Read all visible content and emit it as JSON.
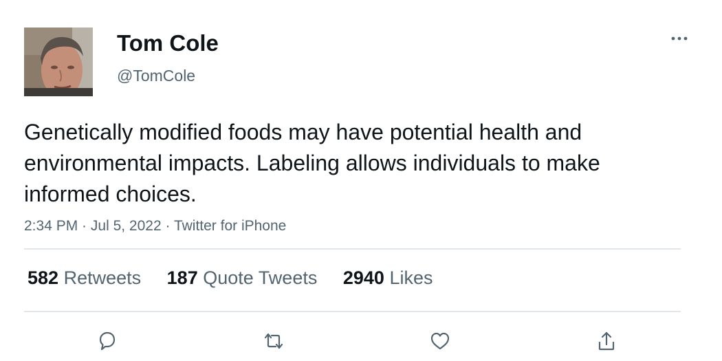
{
  "author": {
    "name": "Tom Cole",
    "handle": "@TomCole"
  },
  "tweet": {
    "text": "Genetically modified foods may have potential health and environmental impacts. Labeling allows individuals to make informed choices.",
    "time": "2:34 PM",
    "separator1": " · ",
    "date": "Jul 5, 2022",
    "separator2": " · ",
    "source": "Twitter for iPhone"
  },
  "stats": {
    "retweets": {
      "count": "582",
      "label": "Retweets"
    },
    "quotes": {
      "count": "187",
      "label": "Quote Tweets"
    },
    "likes": {
      "count": "2940",
      "label": "Likes"
    }
  },
  "icons": {
    "more": "more-icon",
    "reply": "reply-icon",
    "retweet": "retweet-icon",
    "like": "heart-icon",
    "share": "share-icon"
  },
  "colors": {
    "text": "#0f1419",
    "secondary": "#536471",
    "divider": "#e1e6ea"
  }
}
